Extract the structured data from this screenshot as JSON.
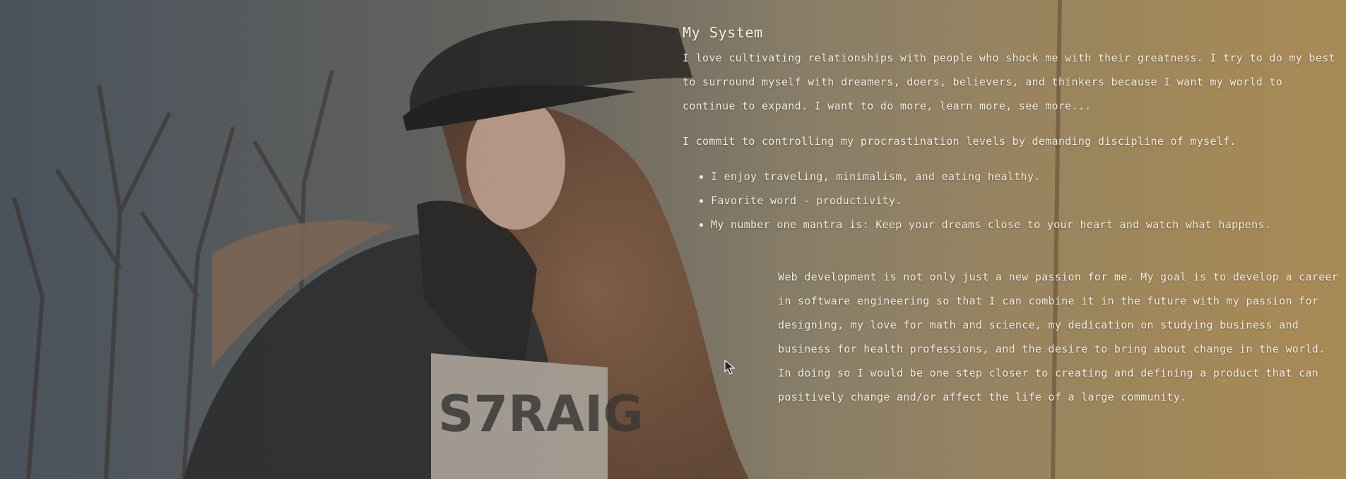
{
  "section": {
    "title": "My System",
    "paragraph1": "I love cultivating relationships with people who shock me with their greatness. I try to do my best to surround myself with dreamers, doers, believers, and thinkers because I want my world to continue to expand. I want to do more, learn more, see more...",
    "paragraph2": "I commit to controlling my procrastination levels by demanding discipline of myself.",
    "list": [
      "I enjoy traveling, minimalism, and eating healthy.",
      "Favorite word - productivity.",
      "My number one mantra is: Keep your dreams close to your heart and watch what happens."
    ],
    "paragraph3": "Web development is not only just a new passion for me. My goal is to develop a career in software engineering so that I can combine it in the future with my passion for designing, my love for math and science, my dedication on studying business and business for health professions, and the desire to bring about change in the world. In doing so I would be one step closer to creating and defining a product that can positively change and/or affect the life of a large community."
  },
  "background": {
    "description_icon": "portrait-photo",
    "accent_color": "#a8895a"
  }
}
